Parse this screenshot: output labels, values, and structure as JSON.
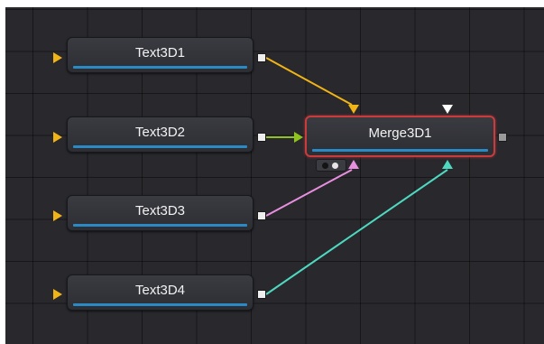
{
  "canvas": {
    "background": "#28282d"
  },
  "nodes": {
    "text3d1": {
      "label": "Text3D1"
    },
    "text3d2": {
      "label": "Text3D2"
    },
    "text3d3": {
      "label": "Text3D3"
    },
    "text3d4": {
      "label": "Text3D4"
    },
    "merge3d1": {
      "label": "Merge3D1",
      "selected": true
    }
  },
  "connections": [
    {
      "from": "Text3D1",
      "to": "Merge3D1",
      "color": "#f0b416"
    },
    {
      "from": "Text3D2",
      "to": "Merge3D1",
      "color": "#8fc21e"
    },
    {
      "from": "Text3D3",
      "to": "Merge3D1",
      "color": "#e98fe0"
    },
    {
      "from": "Text3D4",
      "to": "Merge3D1",
      "color": "#4fd8c0"
    }
  ],
  "colors": {
    "selection": "#c93c3c",
    "node_bar": "#2a8ac5",
    "input_arrow": "#f0b416"
  }
}
